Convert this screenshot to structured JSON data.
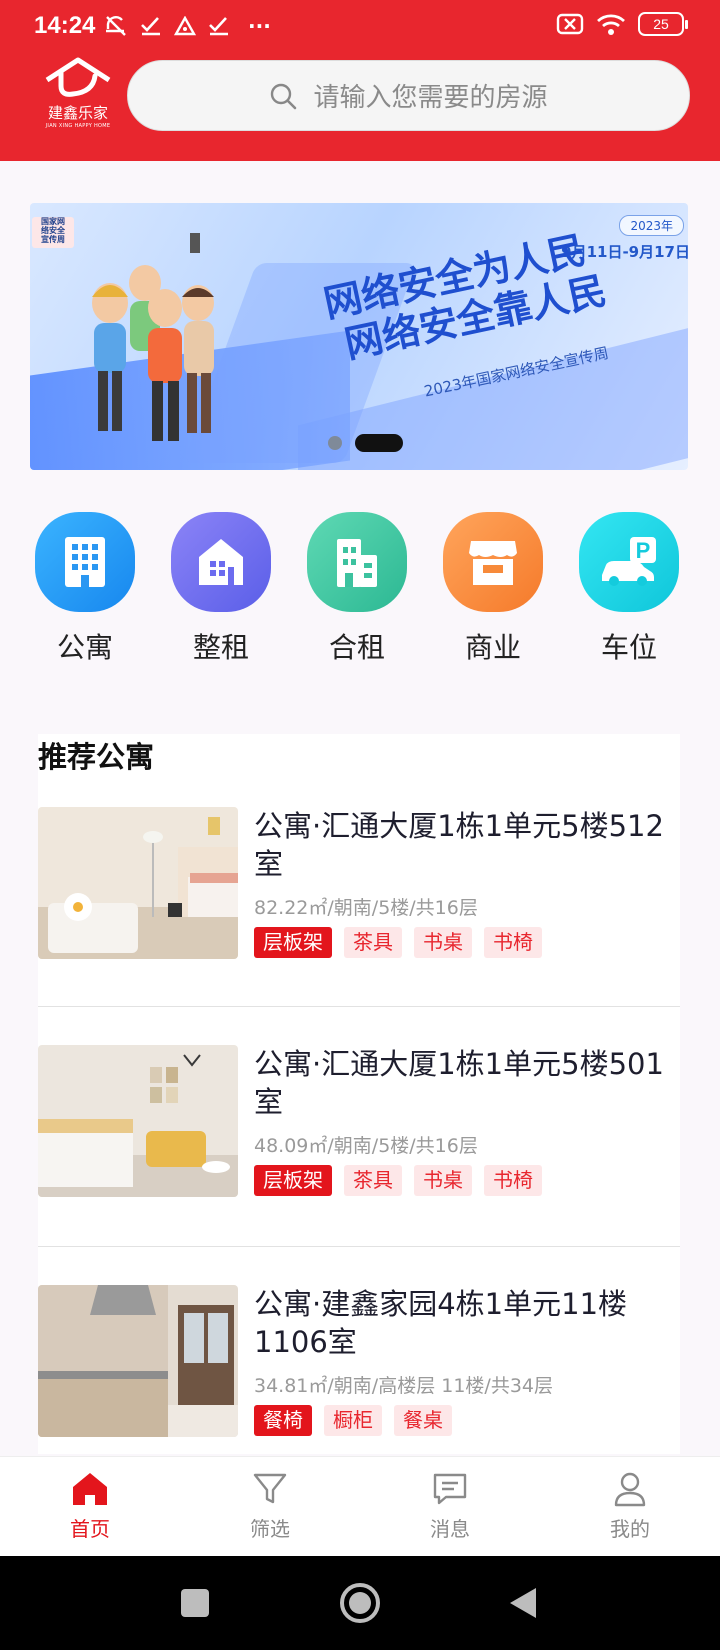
{
  "status_bar": {
    "time": "14:24",
    "more": "···",
    "battery": "25"
  },
  "header": {
    "logo_cn": "建鑫乐家",
    "logo_en": "JIAN XING HAPPY HOME",
    "search_placeholder": "请输入您需要的房源"
  },
  "banner": {
    "corner_tag": "国家网络安全宣传周",
    "year": "2023年",
    "dates": "9月11日-9月17日",
    "slogan_line1": "网络安全为人民",
    "slogan_line2": "网络安全靠人民",
    "subtitle": "2023年国家网络安全宣传周"
  },
  "categories": [
    {
      "label": "公寓",
      "color": "#1f9cf5",
      "icon": "apartment-icon"
    },
    {
      "label": "整租",
      "color": "#6f6ef0",
      "icon": "house-icon"
    },
    {
      "label": "合租",
      "color": "#3ec9a6",
      "icon": "building-icon"
    },
    {
      "label": "商业",
      "color": "#fb8c3b",
      "icon": "shop-icon"
    },
    {
      "label": "车位",
      "color": "#18d6e6",
      "icon": "parking-icon"
    }
  ],
  "recommend": {
    "title": "推荐公寓",
    "items": [
      {
        "name": "公寓·汇通大厦1栋1单元5楼512室",
        "meta": "82.22㎡/朝南/5楼/共16层",
        "tags": [
          "层板架",
          "茶具",
          "书桌",
          "书椅"
        ]
      },
      {
        "name": "公寓·汇通大厦1栋1单元5楼501室",
        "meta": "48.09㎡/朝南/5楼/共16层",
        "tags": [
          "层板架",
          "茶具",
          "书桌",
          "书椅"
        ]
      },
      {
        "name": "公寓·建鑫家园4栋1单元11楼1106室",
        "meta": "34.81㎡/朝南/高楼层 11楼/共34层",
        "tags": [
          "餐椅",
          "橱柜",
          "餐桌"
        ]
      }
    ]
  },
  "bottom_nav": [
    {
      "label": "首页",
      "icon": "home-icon",
      "active": true
    },
    {
      "label": "筛选",
      "icon": "filter-icon",
      "active": false
    },
    {
      "label": "消息",
      "icon": "message-icon",
      "active": false
    },
    {
      "label": "我的",
      "icon": "user-icon",
      "active": false
    }
  ],
  "colors": {
    "brand_red": "#e8262e",
    "tag_red": "#e3151c",
    "tag_pink_bg": "#fde7e8"
  }
}
